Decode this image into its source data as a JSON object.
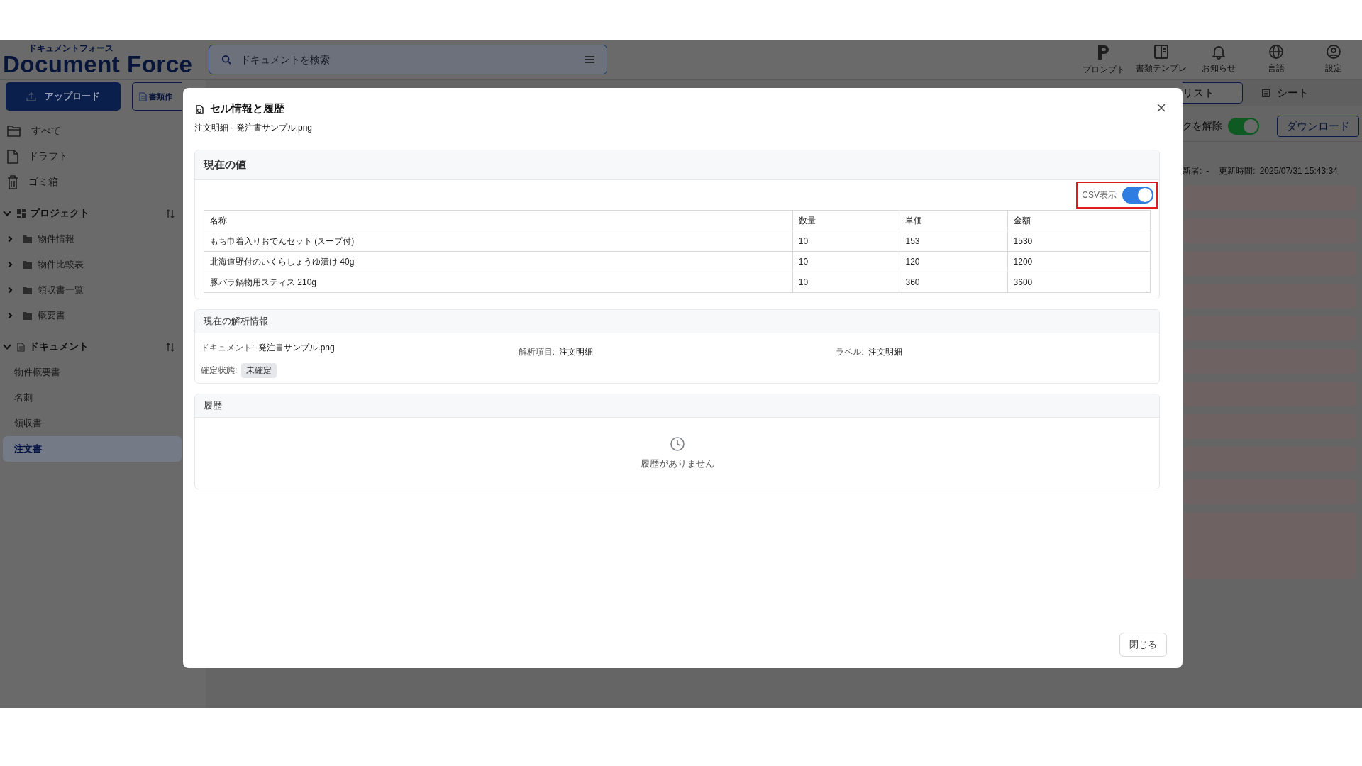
{
  "header": {
    "logo_kana": "ドキュメントフォース",
    "logo": "Document Force",
    "search": {
      "placeholder": "ドキュメントを検索"
    },
    "nav": [
      {
        "label": "プロンプト"
      },
      {
        "label": "書類テンプレ"
      },
      {
        "label": "お知らせ"
      },
      {
        "label": "言語"
      },
      {
        "label": "設定"
      }
    ]
  },
  "sidebar": {
    "upload_button": "アップロード",
    "create_button": "書類作",
    "nav": [
      {
        "label": "すべて"
      },
      {
        "label": "ドラフト"
      },
      {
        "label": "ゴミ箱"
      }
    ],
    "projects": {
      "title": "プロジェクト",
      "expanded": true,
      "folders": [
        {
          "label": "物件情報",
          "expanded": false
        },
        {
          "label": "物件比較表",
          "expanded": false
        },
        {
          "label": "領収書一覧",
          "expanded": false
        },
        {
          "label": "概要書",
          "expanded": false
        }
      ]
    },
    "documents": {
      "title": "ドキュメント",
      "expanded": true,
      "items": [
        {
          "label": "物件概要書",
          "selected": false
        },
        {
          "label": "名刺",
          "selected": false
        },
        {
          "label": "領収書",
          "selected": false
        },
        {
          "label": "注文書",
          "selected": true
        }
      ]
    }
  },
  "main": {
    "view_tabs": [
      {
        "label": "リスト",
        "selected": true
      },
      {
        "label": "シート",
        "selected": false
      }
    ],
    "lock_toggle": {
      "label": "クを解除",
      "on": true
    },
    "download_button": "ダウンロード",
    "meta": [
      {
        "label": "新者:",
        "value": "-"
      },
      {
        "label": "更新時間:",
        "value": "2025/07/31 15:43:34"
      }
    ]
  },
  "modal": {
    "title": "セル情報と履歴",
    "subtitle": "注文明細 - 発注書サンプル.png",
    "current_value": {
      "title": "現在の値",
      "csv_toggle": {
        "label": "CSV表示",
        "on": true,
        "highlighted": true
      },
      "table": {
        "columns": [
          "名称",
          "数量",
          "単価",
          "金額"
        ],
        "rows": [
          [
            "もち巾着入りおでんセット (スープ付)",
            "10",
            "153",
            "1530"
          ],
          [
            "北海道野付のいくらしょうゆ漬け 40g",
            "10",
            "120",
            "1200"
          ],
          [
            "豚バラ鍋物用スティス 210g",
            "10",
            "360",
            "3600"
          ]
        ]
      }
    },
    "analysis": {
      "title": "現在の解析情報",
      "fields": [
        {
          "label": "ドキュメント:",
          "value": "発注書サンプル.png"
        },
        {
          "label": "解析項目:",
          "value": "注文明細"
        },
        {
          "label": "ラベル:",
          "value": "注文明細"
        }
      ],
      "status": {
        "label": "確定状態:",
        "value": "未確定"
      }
    },
    "history": {
      "title": "履歴",
      "empty_text": "履歴がありません"
    },
    "close_button": "閉じる"
  }
}
